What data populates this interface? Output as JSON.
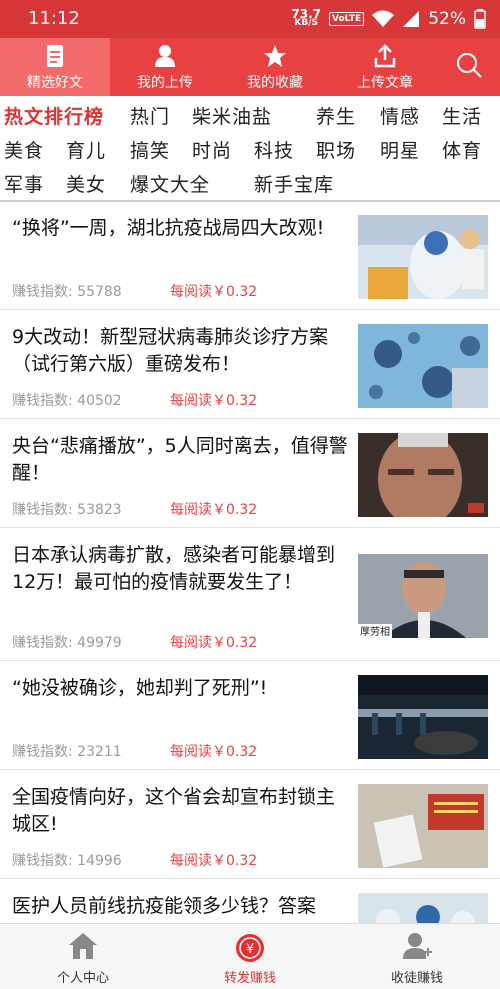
{
  "status": {
    "time": "11:12",
    "net_speed": "73.7",
    "net_unit": "KB/S",
    "volte": "VoLTE",
    "battery": "52%"
  },
  "topnav": [
    {
      "label": "精选好文",
      "icon": "document-icon"
    },
    {
      "label": "我的上传",
      "icon": "person-icon"
    },
    {
      "label": "我的收藏",
      "icon": "star-icon"
    },
    {
      "label": "上传文章",
      "icon": "upload-icon"
    }
  ],
  "categories": [
    "热文排行榜",
    "热门",
    "柴米油盐",
    "养生",
    "情感",
    "生活",
    "美食",
    "育儿",
    "搞笑",
    "时尚",
    "科技",
    "职场",
    "明星",
    "体育",
    "军事",
    "美女",
    "爆文大全",
    "新手宝库"
  ],
  "meta_label": "赚钱指数:",
  "price_label": "每阅读￥0.32",
  "articles": [
    {
      "title": "“换将”一周，湖北抗疫战局四大改观!",
      "index": "55788"
    },
    {
      "title": "9大改动！新型冠状病毒肺炎诊疗方案（试行第六版）重磅发布！",
      "index": "40502"
    },
    {
      "title": "央台“悲痛播放”，5人同时离去，值得警醒！",
      "index": "53823"
    },
    {
      "title": "日本承认病毒扩散，感染者可能暴增到12万！最可怕的疫情就要发生了！",
      "index": "49979"
    },
    {
      "title": "“她没被确诊，她却判了死刑”!",
      "index": "23211"
    },
    {
      "title": "全国疫情向好，这个省会却宣布封锁主城区!",
      "index": "14996"
    },
    {
      "title": "医护人员前线抗疫能领多少钱？答案",
      "index": ""
    }
  ],
  "thumb_captions": {
    "a4": "厚劳相"
  },
  "bottom": [
    {
      "label": "个人中心",
      "icon": "home-icon"
    },
    {
      "label": "转发赚钱",
      "icon": "yuan-coin-icon"
    },
    {
      "label": "收徒赚钱",
      "icon": "add-friend-icon"
    }
  ],
  "colors": {
    "primary": "#e84142",
    "status_bar": "#d8373a",
    "active_tab": "#f26a6a",
    "accent_text": "#e2312f"
  }
}
